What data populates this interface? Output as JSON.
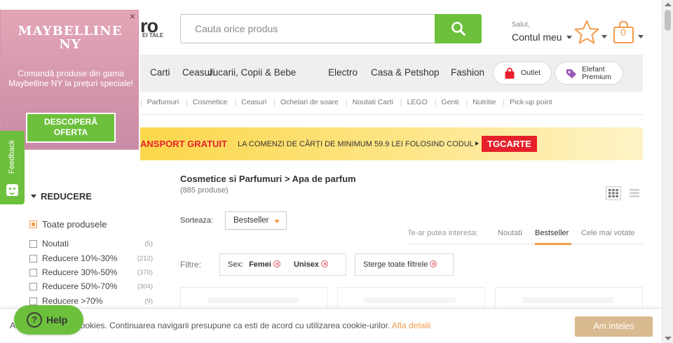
{
  "header": {
    "logo_fragment": "ro",
    "logo_sub": "EI TALE",
    "search_placeholder": "Cauta orice produs",
    "salut": "Salut,",
    "account_label": "Contul meu",
    "cart_count": "0"
  },
  "catnav": {
    "items": [
      "Carti",
      "Ceasuri",
      "Jucarii, Copii & Bebe",
      "Electro",
      "Casa & Petshop",
      "Fashion"
    ],
    "outlet": "Outlet",
    "premium_line1": "Elefant",
    "premium_line2": "Premium"
  },
  "subnav": {
    "items": [
      "Parfumuri",
      "Cosmetice",
      "Ceasuri",
      "Ochelari de soare",
      "Noutati Carti",
      "LEGO",
      "Genti",
      "Nutritie",
      "Pick-up point"
    ]
  },
  "promo": {
    "highlight": "ANSPORT GRATUIT",
    "text": "LA COMENZI DE CĂRȚI DE MINIMUM 59.9 LEI FOLOSIND CODUL",
    "code": "TGCARTE"
  },
  "sidebar": {
    "title": "REDUCERE",
    "filters": [
      {
        "label": "Toate produsele",
        "count": "",
        "checked": true
      },
      {
        "label": "Noutati",
        "count": "(5)",
        "checked": false
      },
      {
        "label": "Reducere 10%-30%",
        "count": "(212)",
        "checked": false
      },
      {
        "label": "Reducere 30%-50%",
        "count": "(370)",
        "checked": false
      },
      {
        "label": "Reducere 50%-70%",
        "count": "(304)",
        "checked": false
      },
      {
        "label": "Reducere >70%",
        "count": "(9)",
        "checked": false
      }
    ]
  },
  "main": {
    "breadcrumb_parent": "Cosmetice si Parfumuri",
    "breadcrumb_sep": ">",
    "breadcrumb_current": "Apa de parfum",
    "product_count": "(885 produse)",
    "sort_label": "Sorteaza:",
    "sort_value": "Bestseller",
    "interest_label": "Te-ar putea interesa:",
    "tabs": [
      "Noutati",
      "Bestseller",
      "Cele mai votate"
    ],
    "active_tab": "Bestseller",
    "filters_label": "Filtre:",
    "chip_sex_label": "Sex:",
    "chip_sex_values": [
      "Femei",
      "Unisex"
    ],
    "clear_filters": "Sterge toate filtrele"
  },
  "popup": {
    "close": "×",
    "brand_line1": "MAYBELLINE",
    "brand_line2": "NY",
    "message": "Comandă produse din gama Maybelline NY la prețuri speciale!",
    "button_line1": "DESCOPERĂ",
    "button_line2": "OFERTA"
  },
  "feedback": {
    "label": "Feedback"
  },
  "cookie": {
    "prefix": "A",
    "text": "e cookies. Continuarea navigarii presupune ca esti de acord cu utilizarea cookie-urilor.",
    "link": "Afla detalii",
    "accept": "Am inteles"
  },
  "help": {
    "icon": "?",
    "label": "Help"
  },
  "colors": {
    "accent_green": "#6cc03c",
    "accent_orange": "#f39c4a",
    "promo_red": "#e5212b",
    "popup_pink": "#d496a9"
  }
}
